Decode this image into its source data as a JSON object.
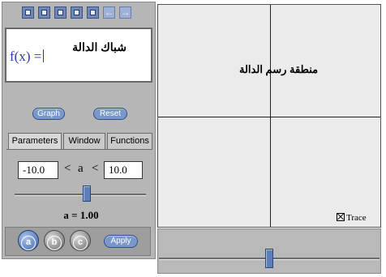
{
  "toolbar": {
    "icons": [
      "window-icon",
      "window-icon",
      "window-icon",
      "window-icon",
      "window-icon",
      "arrow-left-icon",
      "arrow-right-icon"
    ],
    "arrow_left_glyph": "←",
    "arrow_right_glyph": "→"
  },
  "function_box": {
    "prefix": "f(x) =",
    "title": "شباك الدالة"
  },
  "buttons": {
    "graph": "Graph",
    "reset": "Reset",
    "apply": "Apply"
  },
  "tabs": [
    {
      "label": "Parameters",
      "active": true
    },
    {
      "label": "Window",
      "active": false
    },
    {
      "label": "Functions",
      "active": false
    }
  ],
  "parameters": {
    "min": "-10.0",
    "max": "10.0",
    "lt_left": "<",
    "var": "a",
    "lt_right": "<",
    "current": "a = 1.00",
    "slider_fraction": 0.55,
    "selectors": [
      {
        "label": "a",
        "selected": true
      },
      {
        "label": "b",
        "selected": false
      },
      {
        "label": "c",
        "selected": false
      }
    ]
  },
  "graph_area": {
    "label": "منطقة رسم الدالة",
    "trace_label": "Trace",
    "trace_checked": true,
    "bottom_slider_fraction": 0.5
  },
  "colors": {
    "accent": "#5f7fb8",
    "panel": "#b6b6b6",
    "graph_bg": "#ebebeb"
  }
}
